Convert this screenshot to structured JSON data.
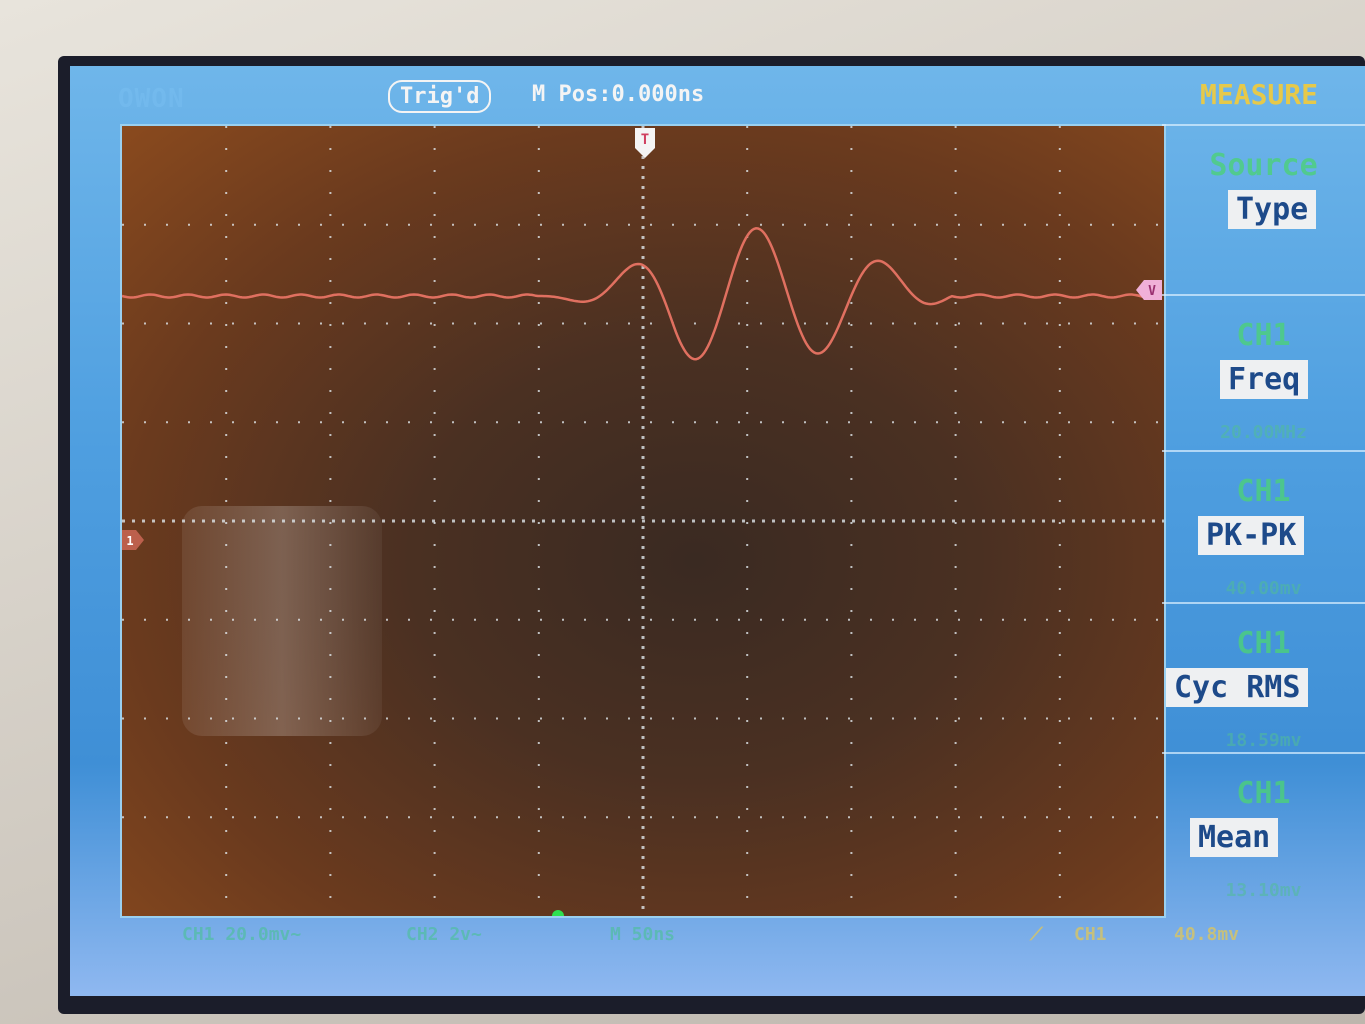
{
  "header": {
    "brand": "OWON",
    "trigger_status": "Trig'd",
    "horizontal_position": "M Pos:0.000ns",
    "menu_title": "MEASURE"
  },
  "menu": {
    "items": [
      {
        "head": "Source",
        "label": "Type",
        "value": ""
      },
      {
        "head": "CH1",
        "label": "Freq",
        "value": "20.00MHz"
      },
      {
        "head": "CH1",
        "label": "PK-PK",
        "value": "40.00mv"
      },
      {
        "head": "CH1",
        "label": "Cyc RMS",
        "value": "18.59mv"
      },
      {
        "head": "CH1",
        "label": "Mean",
        "value": "13.10mv"
      }
    ]
  },
  "status": {
    "ch1_scale": "CH1 20.0mv~",
    "ch2_scale": "CH2 2v~",
    "timebase": "M 50ns",
    "trigger_source": "CH1",
    "trigger_level": "40.8mv"
  },
  "colors": {
    "trace": "#e07060",
    "grid": "#dfe6ea",
    "menu_head": "#4cd17a",
    "menu_title": "#e6c94a"
  },
  "icons": {
    "trigger_marker": "T",
    "level_marker": "V",
    "ch1_marker": "1"
  }
}
